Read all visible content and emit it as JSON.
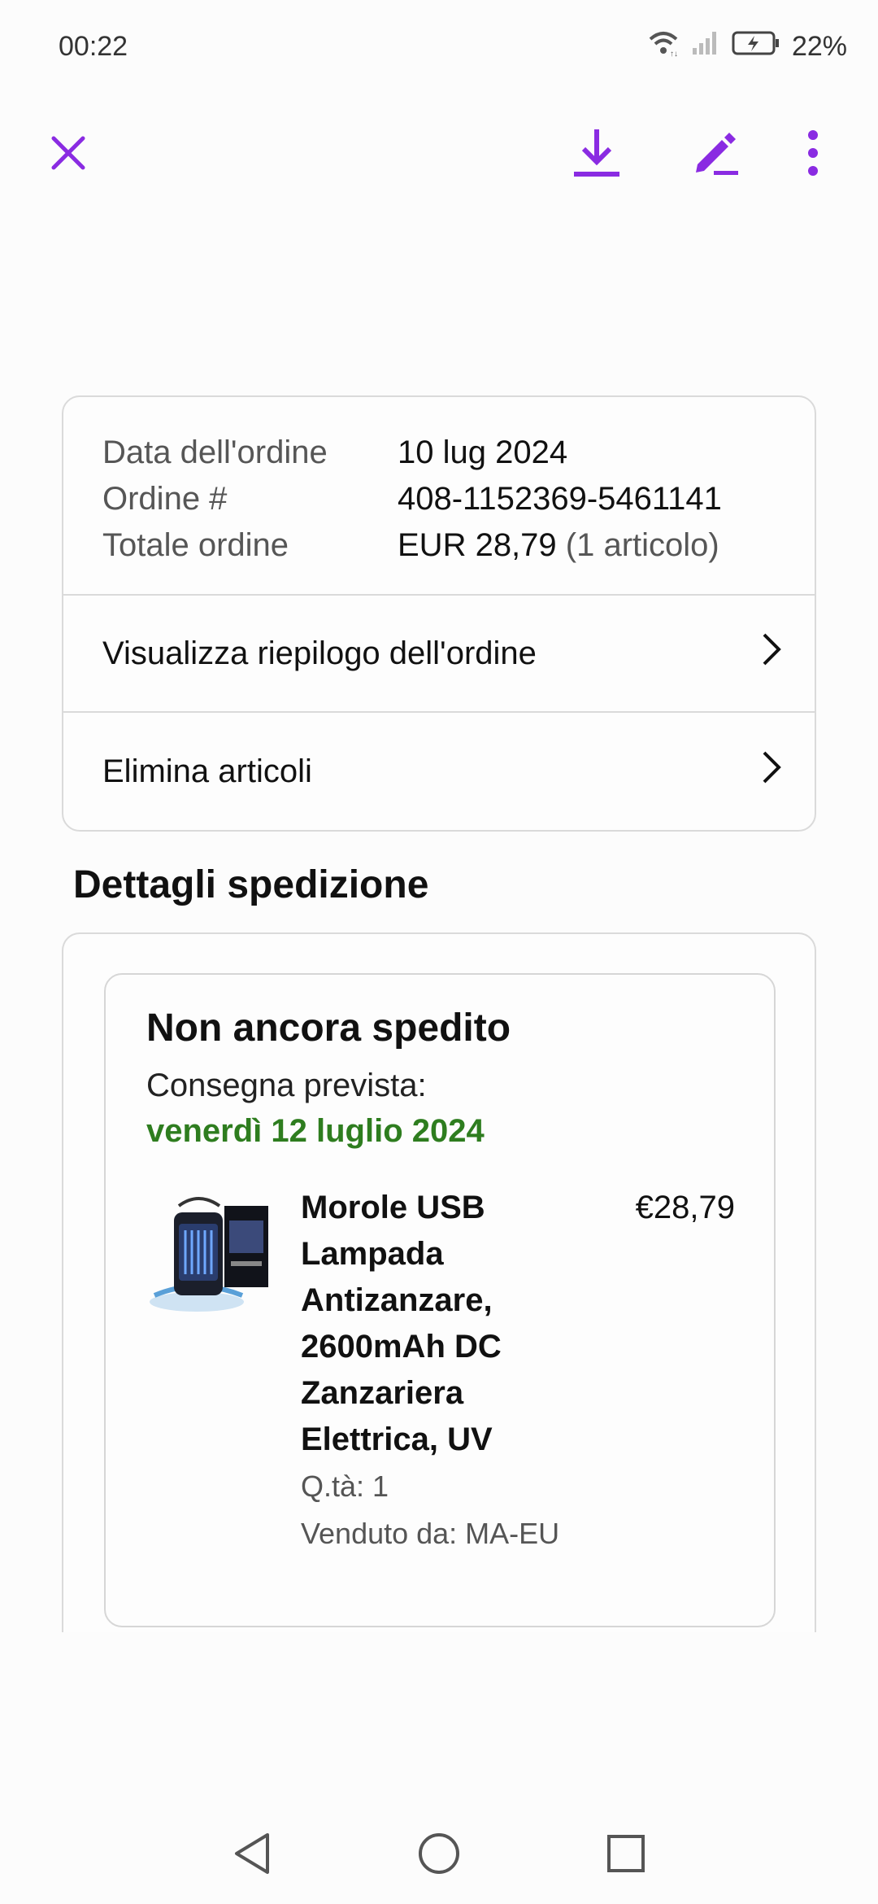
{
  "status_bar": {
    "time": "00:22",
    "battery": "22%",
    "icons": [
      "wifi-icon",
      "signal-icon",
      "battery-charging-icon"
    ]
  },
  "app_bar": {
    "icons": [
      "close-icon",
      "download-icon",
      "edit-icon",
      "more-vert-icon"
    ],
    "accent": "#8a2be2"
  },
  "order": {
    "date_label": "Data dell'ordine",
    "date_value": "10 lug 2024",
    "number_label": "Ordine #",
    "number_value": "408-1152369-5461141",
    "total_label": "Totale ordine",
    "total_value": "EUR 28,79",
    "total_items": "(1 articolo)",
    "view_summary": "Visualizza riepilogo dell'ordine",
    "delete_items": "Elimina articoli"
  },
  "shipment": {
    "section_title": "Dettagli spedizione",
    "status": "Non ancora spedito",
    "delivery_label": "Consegna prevista:",
    "delivery_date": "venerdì 12 luglio 2024",
    "delivery_color": "#2e7d1f",
    "product": {
      "title": "Morole USB Lampada Antizanzare, 2600mAh DC Zanzariera Elettrica, UV",
      "price": "€28,79",
      "quantity": "Q.tà: 1",
      "seller": "Venduto da: MA-EU"
    }
  },
  "nav_bar": {
    "icons": [
      "back-icon",
      "home-icon",
      "recents-icon"
    ]
  }
}
